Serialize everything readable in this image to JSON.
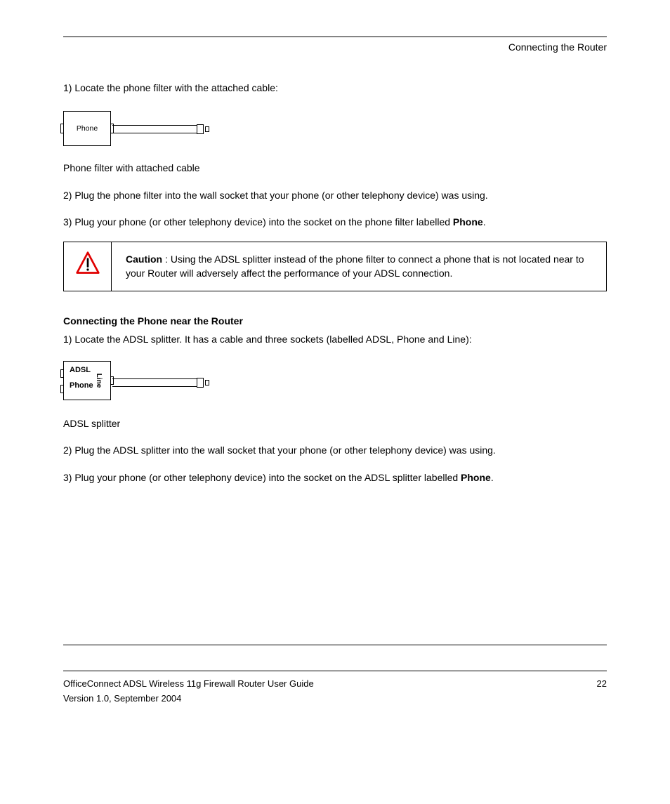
{
  "header": {
    "title": "Connecting the Router"
  },
  "section1": {
    "intro": "1) Locate the phone filter with the attached cable:",
    "diagram": {
      "box_label": "Phone",
      "caption": "Phone filter with attached cable"
    },
    "step2": "2) Plug the phone filter into the wall socket that your phone (or other telephony device) was using.",
    "step3_a": "3) Plug your phone (or other telephony device) into the socket on the phone filter labelled ",
    "step3_phone": "Phone",
    "step3_b": "."
  },
  "caution": {
    "label": "Caution",
    "text": ": Using the ADSL splitter instead of the phone filter to connect a phone that is not located near to your Router will adversely affect the performance of your ADSL connection."
  },
  "section2": {
    "title": "Connecting the Phone near the Router",
    "intro": "1) Locate the ADSL splitter. It has a cable and three sockets (labelled ADSL, Phone and Line):",
    "diagram": {
      "box_label_adsl": "ADSL",
      "box_label_phone": "Phone",
      "box_label_line": "Line",
      "caption": "ADSL splitter"
    },
    "step2": "2) Plug the ADSL splitter into the wall socket that your phone (or other telephony device) was using.",
    "step3_a": "3) Plug your phone (or other telephony device) into the socket on the ADSL splitter labelled ",
    "step3_phone": "Phone",
    "step3_b": "."
  },
  "footer": {
    "left": "OfficeConnect ADSL Wireless 11g Firewall Router User Guide",
    "right": "22",
    "line2": "Version 1.0, September 2004"
  }
}
